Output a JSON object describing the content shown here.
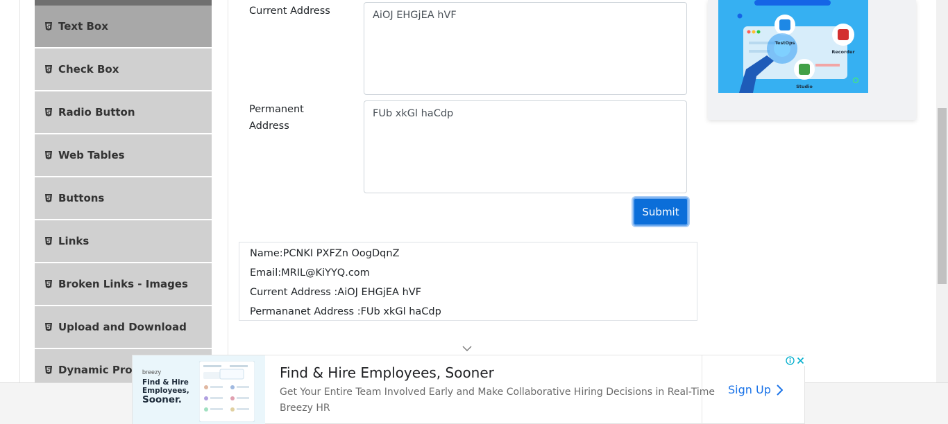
{
  "sidebar": {
    "items": [
      {
        "label": "Text Box",
        "active": true
      },
      {
        "label": "Check Box"
      },
      {
        "label": "Radio Button"
      },
      {
        "label": "Web Tables"
      },
      {
        "label": "Buttons"
      },
      {
        "label": "Links"
      },
      {
        "label": "Broken Links - Images"
      },
      {
        "label": "Upload and Download"
      },
      {
        "label": "Dynamic Properties"
      }
    ]
  },
  "form": {
    "current_address_label": "Current Address",
    "current_address_value": "AiOJ EHGjEA hVF",
    "permanent_address_label_line1": "Permanent",
    "permanent_address_label_line2": "Address",
    "permanent_address_value": "FUb xkGl haCdp",
    "submit_label": "Submit"
  },
  "output": {
    "name": "Name:PCNKI PXFZn OogDqnZ",
    "email": "Email:MRIL@KiYYQ.com",
    "current_address": "Current Address :AiOJ EHGjEA hVF",
    "permanent_address": "Permananet Address :FUb xkGl haCdp"
  },
  "side_ad": {
    "labels": [
      "TestOps",
      "Recorder",
      "Studio"
    ]
  },
  "bottom_ad": {
    "thumb_brand": "breezy",
    "thumb_line1": "Find & Hire",
    "thumb_line2": "Employees,",
    "thumb_line3": "Sooner.",
    "headline": "Find & Hire Employees, Sooner",
    "description": "Get Your Entire Team Involved Early and Make Collaborative Hiring Decisions in Real-Time",
    "advertiser": "Breezy HR",
    "cta": "Sign Up"
  },
  "colors": {
    "primary": "#0b6ed9",
    "sidebar_active": "#a8a8a8",
    "sidebar_item": "#d0d0d0"
  }
}
